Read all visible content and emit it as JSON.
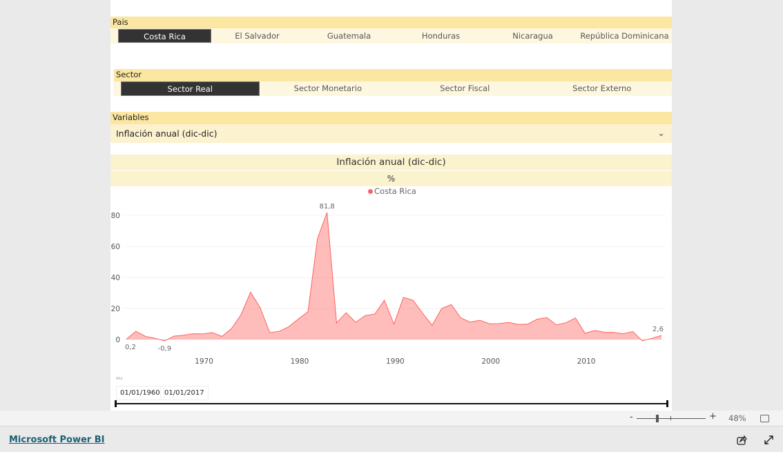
{
  "pais": {
    "title": "Pais",
    "options": [
      "Costa Rica",
      "El Salvador",
      "Guatemala",
      "Honduras",
      "Nicaragua",
      "República Dominicana"
    ],
    "selected": 0
  },
  "sector": {
    "title": "Sector",
    "options": [
      "Sector Real",
      "Sector Monetario",
      "Sector Fiscal",
      "Sector Externo"
    ],
    "selected": 0
  },
  "variables": {
    "title": "Variables",
    "value": "Inflación anual (dic-dic)"
  },
  "chart_data": {
    "type": "area",
    "title": "Inflación anual (dic-dic)",
    "subtitle": "%",
    "series": [
      {
        "name": "Costa Rica",
        "color": "#fd625e",
        "values": [
          0.2,
          5.3,
          2.0,
          0.8,
          -0.9,
          2.2,
          2.8,
          3.7,
          3.6,
          4.5,
          2.0,
          7.0,
          16.0,
          30.5,
          20.5,
          4.5,
          5.3,
          8.2,
          13.2,
          17.8,
          65.0,
          81.8,
          10.7,
          17.3,
          11.1,
          15.4,
          16.4,
          25.3,
          10.0,
          27.1,
          25.3,
          17.0,
          9.2,
          20.0,
          22.5,
          13.9,
          11.2,
          12.4,
          10.1,
          10.2,
          11.0,
          9.7,
          9.9,
          13.1,
          14.1,
          9.4,
          10.8,
          13.9,
          4.0,
          5.8,
          4.7,
          4.6,
          3.7,
          5.1,
          -0.8,
          0.8,
          2.6
        ]
      }
    ],
    "x_start": 1961,
    "x_end": 2017,
    "x_ticks": [
      1970,
      1980,
      1990,
      2000,
      2010
    ],
    "y_ticks": [
      0,
      20,
      40,
      60,
      80
    ],
    "ylim": [
      -2,
      85
    ],
    "data_labels": [
      {
        "year": 1961,
        "text": "0,2"
      },
      {
        "year": 1965,
        "text": "-0,9"
      },
      {
        "year": 1982,
        "text": "81,8"
      },
      {
        "year": 2017,
        "text": "2,6"
      }
    ],
    "grid": true,
    "legend": "top-center"
  },
  "slicer": {
    "label": "Año",
    "start": "01/01/1960",
    "end": "01/01/2017"
  },
  "status": {
    "zoom_minus": "-",
    "zoom_plus": "+",
    "zoom": "48%",
    "zoom_level": 0.3
  },
  "footer": {
    "brand": "Microsoft Power BI"
  }
}
